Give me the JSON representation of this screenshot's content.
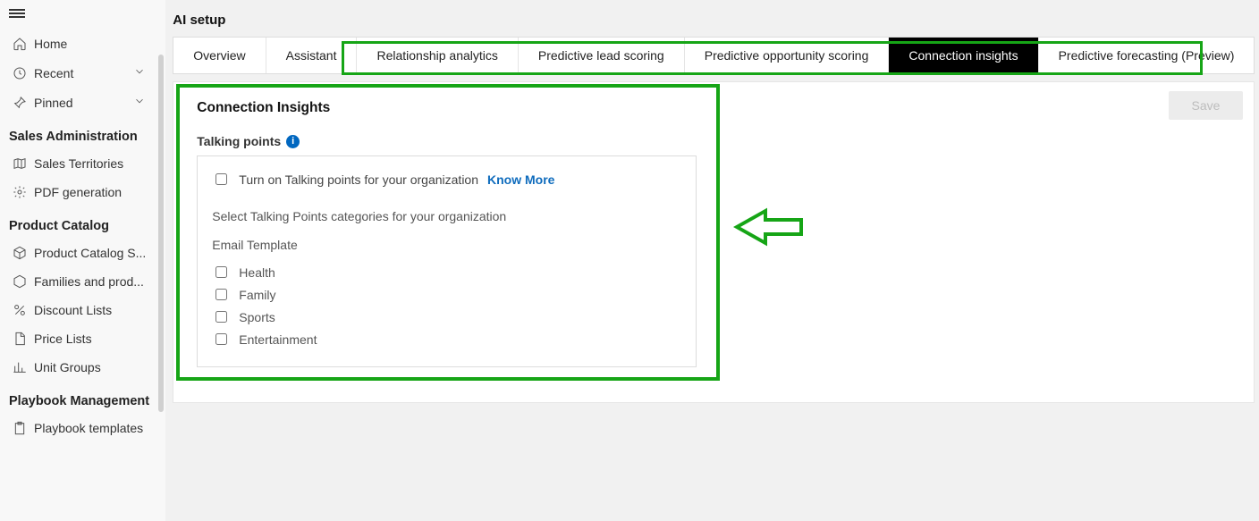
{
  "page": {
    "title": "AI setup"
  },
  "nav": {
    "home": "Home",
    "recent": "Recent",
    "pinned": "Pinned"
  },
  "sections": {
    "salesAdmin": {
      "title": "Sales Administration",
      "items": [
        "Sales Territories",
        "PDF generation"
      ]
    },
    "productCatalog": {
      "title": "Product Catalog",
      "items": [
        "Product Catalog S...",
        "Families and prod...",
        "Discount Lists",
        "Price Lists",
        "Unit Groups"
      ]
    },
    "playbook": {
      "title": "Playbook Management",
      "items": [
        "Playbook templates"
      ]
    }
  },
  "tabs": {
    "overview": "Overview",
    "assistant": "Assistant",
    "relAnalytics": "Relationship analytics",
    "leadScoring": "Predictive lead scoring",
    "oppScoring": "Predictive opportunity scoring",
    "connInsights": "Connection insights",
    "forecasting": "Predictive forecasting (Preview)"
  },
  "actions": {
    "save": "Save"
  },
  "connectionInsights": {
    "heading": "Connection Insights",
    "talkingPointsLabel": "Talking points",
    "turnOnLabel": "Turn on Talking points for your organization",
    "knowMore": "Know More",
    "selectCategories": "Select Talking Points categories for your organization",
    "emailTemplate": "Email Template",
    "categories": [
      "Health",
      "Family",
      "Sports",
      "Entertainment"
    ]
  }
}
